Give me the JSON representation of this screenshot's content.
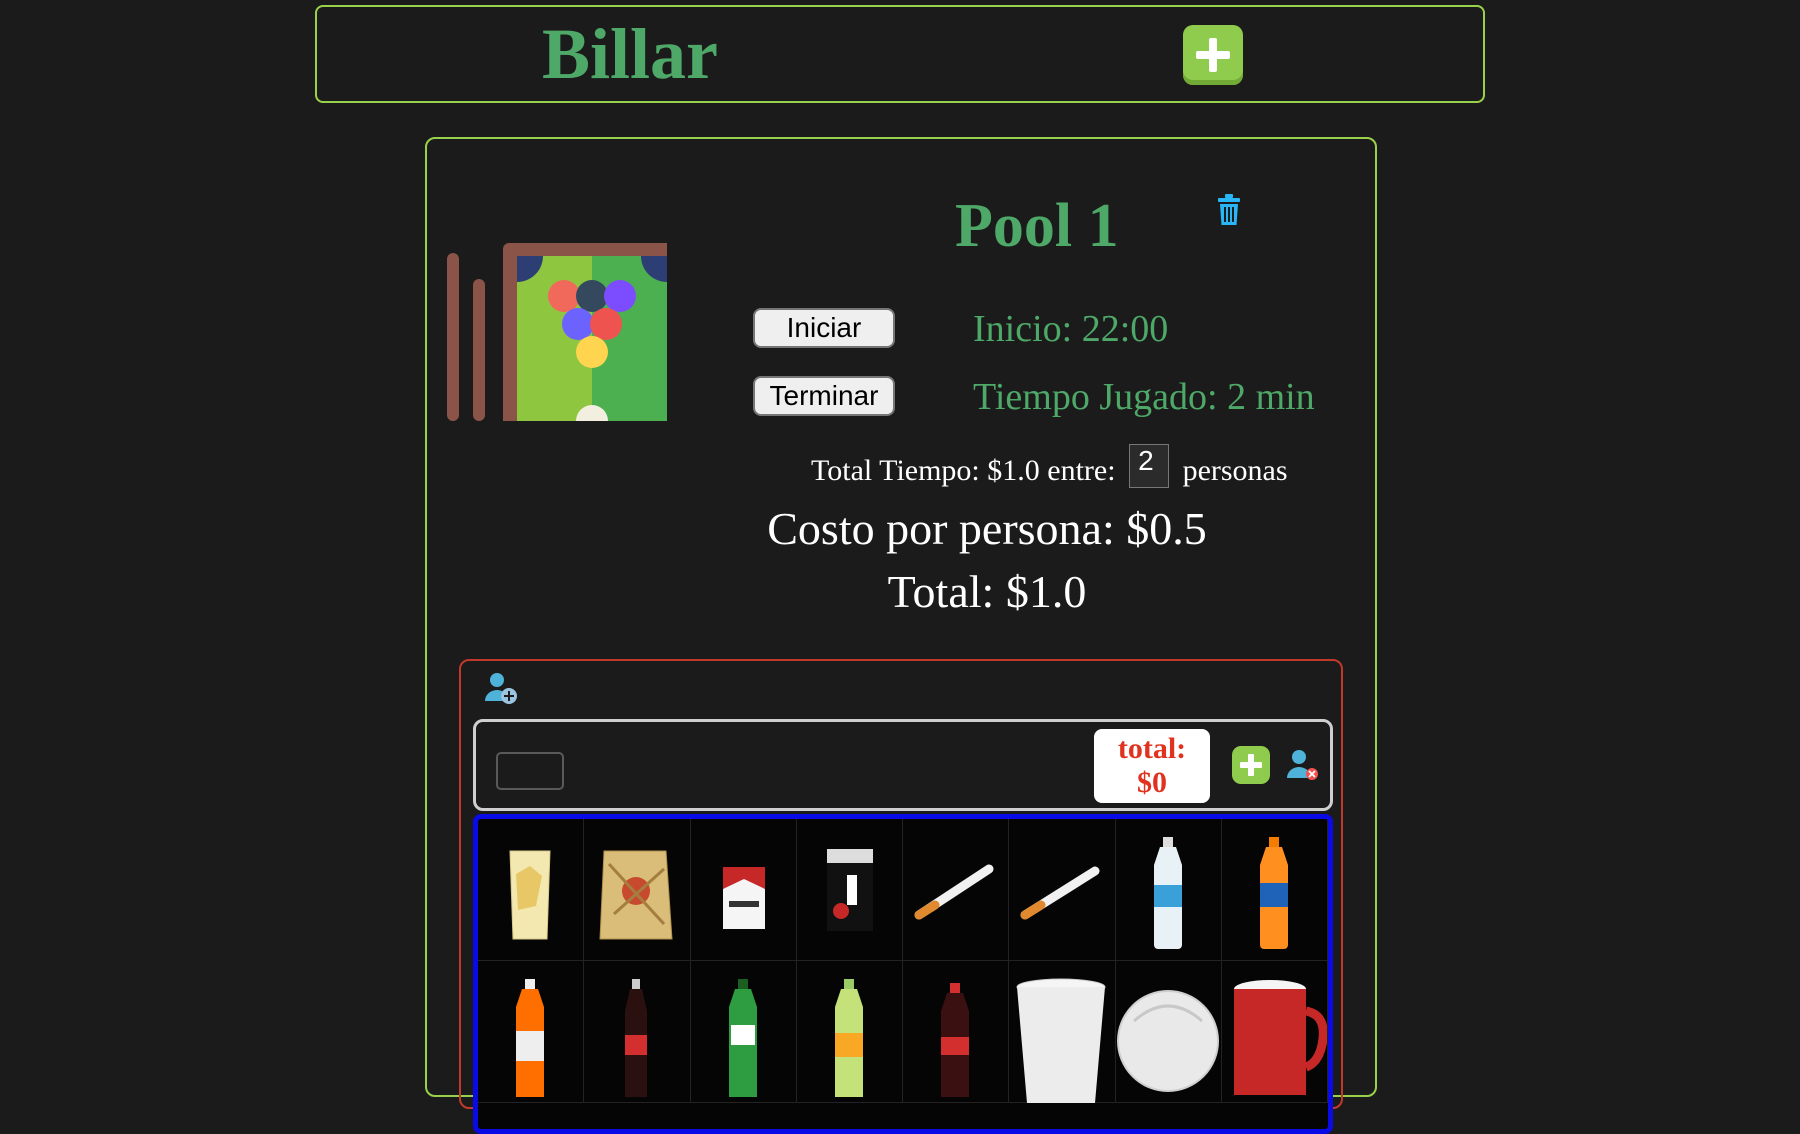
{
  "header": {
    "title": "Billar",
    "add_table_icon": "plus-icon"
  },
  "table": {
    "name": "Pool 1",
    "delete_icon": "trash-icon",
    "start_label": "Iniciar",
    "end_label": "Terminar",
    "inicio_text": "Inicio: 22:00",
    "tiempo_text": "Tiempo Jugado: 2 min",
    "total_tiempo_text": "Total Tiempo: $1.0 entre:",
    "people_count": "2",
    "personas_text": "personas",
    "costo_text": "Costo por persona: $0.5",
    "total_text": "Total: $1.0"
  },
  "people": {
    "add_person_icon": "add-user-icon",
    "rows": [
      {
        "name_value": "",
        "total_label": "total:",
        "total_value": "$0",
        "add_icon": "plus-icon",
        "remove_icon": "remove-user-icon"
      }
    ]
  },
  "products": [
    {
      "name": "papas-fritas-bolsa"
    },
    {
      "name": "papas-bolsa-grande"
    },
    {
      "name": "marlboro-cajetilla"
    },
    {
      "name": "pall-mall-cajetilla"
    },
    {
      "name": "cigarrillo"
    },
    {
      "name": "cigarrillo-pall-mall"
    },
    {
      "name": "agua-botella"
    },
    {
      "name": "naranja-botella"
    },
    {
      "name": "orange-crush-botella"
    },
    {
      "name": "coca-cola-vidrio"
    },
    {
      "name": "7up-botella"
    },
    {
      "name": "squirt-botella"
    },
    {
      "name": "coca-cola-plastico"
    },
    {
      "name": "vaso-plastico"
    },
    {
      "name": "aspirina"
    },
    {
      "name": "taza-roja"
    }
  ],
  "colors": {
    "accent_green": "#9ad14a",
    "title_green": "#4ea868",
    "panel_red": "#c0392b",
    "grid_blue": "#0a0ae6",
    "total_red": "#e0321e"
  }
}
